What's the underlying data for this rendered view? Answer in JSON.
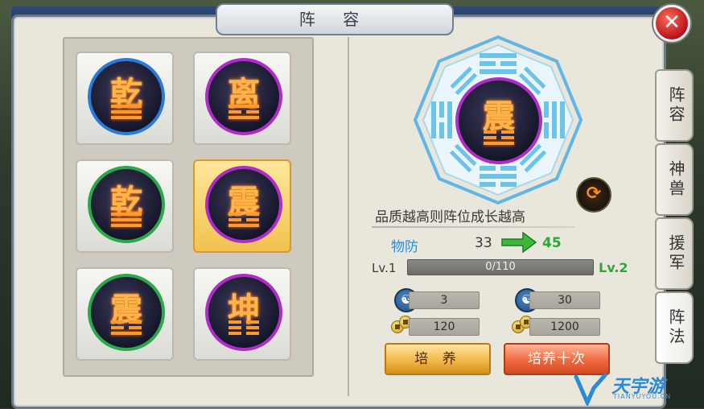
{
  "window": {
    "title": "阵 容"
  },
  "slots": [
    {
      "char": "乾",
      "ring": "blue",
      "trigram": [
        0,
        0,
        0
      ]
    },
    {
      "char": "离",
      "ring": "purple",
      "trigram": [
        0,
        1,
        0
      ]
    },
    {
      "char": "乾",
      "ring": "green",
      "trigram": [
        0,
        0,
        0
      ]
    },
    {
      "char": "震",
      "ring": "purple",
      "trigram": [
        1,
        1,
        0
      ],
      "selected": true
    },
    {
      "char": "震",
      "ring": "green",
      "trigram": [
        1,
        1,
        0
      ]
    },
    {
      "char": "坤",
      "ring": "purple",
      "trigram": [
        1,
        1,
        1
      ]
    }
  ],
  "detail": {
    "center_char": "震",
    "description": "品质越高则阵位成长越高",
    "stat_name": "物防",
    "stat_old": "33",
    "stat_new": "45",
    "level_current": "Lv.1",
    "progress_text": "0/110",
    "progress_fraction": 0,
    "level_next": "Lv.2"
  },
  "costs": {
    "single": {
      "spirit": "3",
      "gold": "120"
    },
    "ten": {
      "spirit": "30",
      "gold": "1200"
    }
  },
  "buttons": {
    "train": "培 养",
    "train_ten": "培养十次"
  },
  "tabs": [
    {
      "label": "阵容"
    },
    {
      "label": "神兽"
    },
    {
      "label": "援军"
    },
    {
      "label": "阵法",
      "active": true
    }
  ],
  "watermark": {
    "text": "天宇游",
    "sub": "TIANYUYOU.CN"
  },
  "colors": {
    "title_bar": "#1d3260",
    "ring_blue": "#2a7bd8",
    "ring_purple": "#b02cc8",
    "ring_green": "#2aa84a",
    "stat_up": "#2aa83a"
  }
}
